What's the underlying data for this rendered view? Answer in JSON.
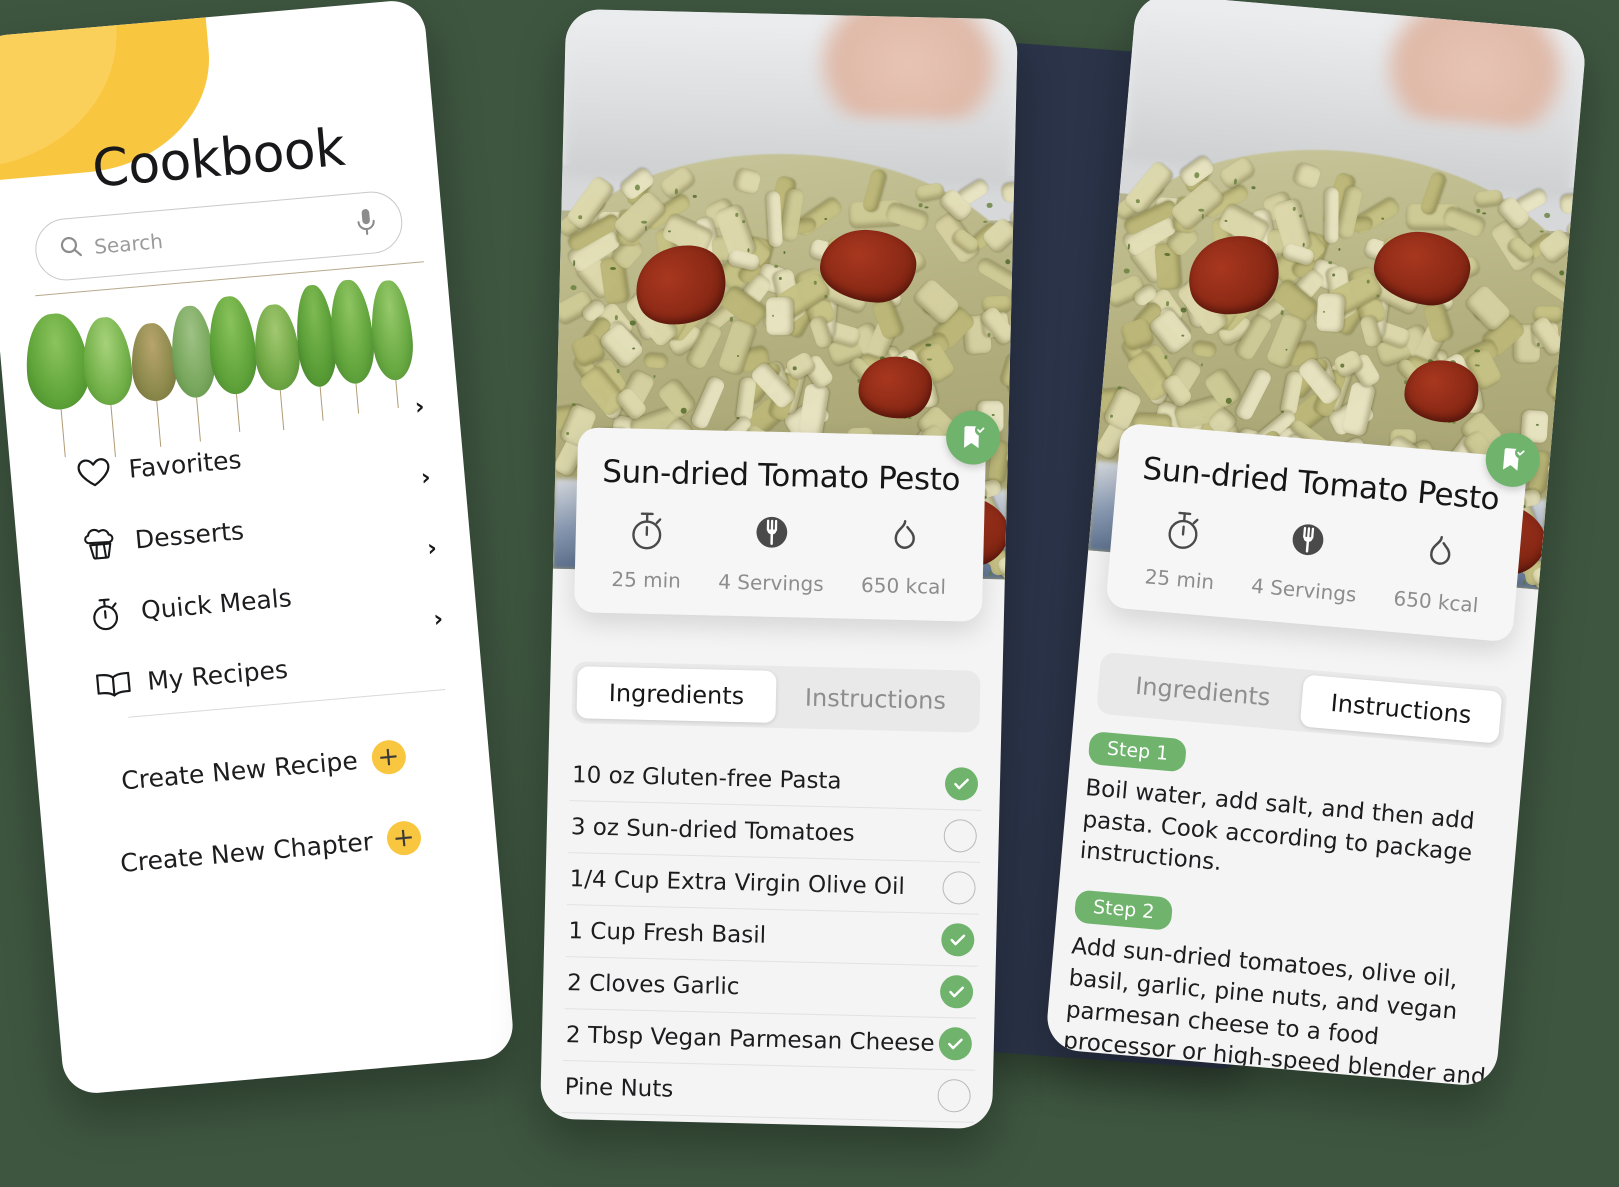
{
  "theme": {
    "background": "#3e5640",
    "accent_yellow": "#f9c63f",
    "accent_green": "#6fb36d",
    "navy_card": "#2b3449"
  },
  "cookbook": {
    "title": "Cookbook",
    "search": {
      "placeholder": "Search",
      "mic_icon": "microphone-icon",
      "icon": "search-icon"
    },
    "menu": [
      {
        "label": "Favorites",
        "icon": "heart-icon",
        "chevron": "›"
      },
      {
        "label": "Desserts",
        "icon": "cupcake-icon",
        "chevron": "›"
      },
      {
        "label": "Quick Meals",
        "icon": "timer-icon",
        "chevron": "›"
      },
      {
        "label": "My Recipes",
        "icon": "book-icon",
        "chevron": "›"
      }
    ],
    "actions": [
      {
        "label": "Create New Recipe",
        "plus": "+"
      },
      {
        "label": "Create New Chapter",
        "plus": "+"
      }
    ]
  },
  "recipe": {
    "title": "Sun-dried Tomato Pesto",
    "bookmark_icon": "bookmark-check-icon",
    "meta": [
      {
        "icon": "timer-icon",
        "value": "25 min"
      },
      {
        "icon": "plate-fork-icon",
        "value": "4 Servings"
      },
      {
        "icon": "flame-icon",
        "value": "650 kcal"
      }
    ],
    "tabs": [
      {
        "label": "Ingredients",
        "active_on_phone2": true,
        "active_on_phone3": false
      },
      {
        "label": "Instructions",
        "active_on_phone2": false,
        "active_on_phone3": true
      }
    ],
    "ingredients": [
      {
        "name": "10 oz Gluten-free Pasta",
        "checked": true
      },
      {
        "name": "3 oz Sun-dried Tomatoes",
        "checked": false
      },
      {
        "name": "1/4 Cup Extra Virgin Olive Oil",
        "checked": false
      },
      {
        "name": "1 Cup Fresh Basil",
        "checked": true
      },
      {
        "name": "2 Cloves Garlic",
        "checked": true
      },
      {
        "name": "2 Tbsp Vegan Parmesan Cheese",
        "checked": true
      },
      {
        "name": "Pine Nuts",
        "checked": false
      }
    ],
    "instructions": [
      {
        "badge": "Step 1",
        "text": "Boil water, add salt, and then add pasta. Cook according to package instructions."
      },
      {
        "badge": "Step 2",
        "text": "Add sun-dried tomatoes, olive oil, basil, garlic, pine nuts, and vegan parmesan cheese to a food processor or high-speed blender and puree into a pesto-like consistency."
      }
    ]
  }
}
